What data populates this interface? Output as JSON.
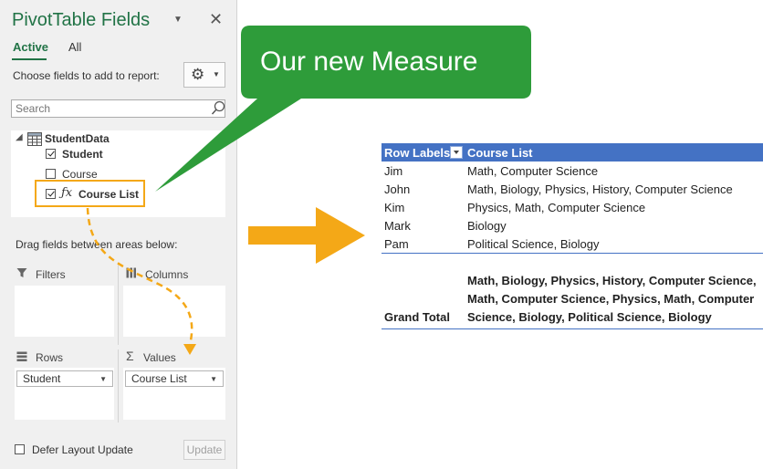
{
  "pane": {
    "title": "PivotTable Fields",
    "tabs": [
      {
        "label": "Active"
      },
      {
        "label": "All"
      }
    ],
    "choose_label": "Choose fields to add to report:",
    "search_placeholder": "Search",
    "table_name": "StudentData",
    "fields": [
      {
        "label": "Student",
        "checked": true
      },
      {
        "label": "Course",
        "checked": false
      },
      {
        "label": "Course List",
        "checked": true
      }
    ],
    "drag_label": "Drag fields between areas below:",
    "areas": {
      "filters": {
        "label": "Filters"
      },
      "columns": {
        "label": "Columns"
      },
      "rows": {
        "label": "Rows",
        "chip": "Student"
      },
      "values": {
        "label": "Values",
        "chip": "Course List"
      }
    },
    "defer_label": "Defer Layout Update",
    "update_label": "Update"
  },
  "callout": {
    "text": "Our new Measure"
  },
  "pivot": {
    "header_left": "Row Labels",
    "header_right": "Course List",
    "rows": [
      {
        "label": "Jim",
        "value": "Math, Computer Science"
      },
      {
        "label": "John",
        "value": "Math, Biology, Physics, History, Computer Science"
      },
      {
        "label": "Kim",
        "value": "Physics, Math, Computer Science"
      },
      {
        "label": "Mark",
        "value": "Biology"
      },
      {
        "label": "Pam",
        "value": "Political Science, Biology"
      }
    ],
    "grand_total_label": "Grand Total",
    "grand_total_lines": [
      "Math, Biology, Physics, History, Computer Science,",
      "Math, Computer Science, Physics, Math, Computer",
      "Science, Biology, Political Science, Biology"
    ]
  },
  "colors": {
    "excel_green": "#217346",
    "callout_green": "#2e9c3a",
    "highlight_orange": "#f4a817",
    "pivot_blue": "#4472c4"
  }
}
